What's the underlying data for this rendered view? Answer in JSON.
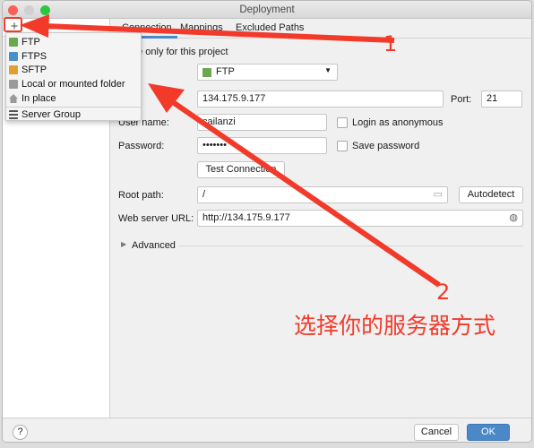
{
  "window": {
    "title": "Deployment"
  },
  "sidebar": {
    "add_button": "+"
  },
  "add_menu": {
    "items": [
      {
        "label": "FTP",
        "icon": "ftp-icon",
        "color": "#6aa84f"
      },
      {
        "label": "FTPS",
        "icon": "ftps-icon",
        "color": "#4a90c8"
      },
      {
        "label": "SFTP",
        "icon": "sftp-icon",
        "color": "#e0a030"
      },
      {
        "label": "Local or mounted folder",
        "icon": "folder-icon",
        "color": "#9a9a9a"
      },
      {
        "label": "In place",
        "icon": "home-icon",
        "color": "#9a9a9a"
      },
      {
        "label": "Server Group",
        "icon": "list-icon",
        "color": "#555555"
      }
    ]
  },
  "tabs": [
    {
      "label": "Connection",
      "active": true
    },
    {
      "label": "Mappings"
    },
    {
      "label": "Excluded Paths"
    }
  ],
  "form": {
    "visible_only": "Visible only for this project",
    "type_value": "FTP",
    "host_value": "134.175.9.177",
    "port_label": "Port:",
    "port_value": "21",
    "username_label": "User name:",
    "username_value": "cailanzi",
    "login_anonymous": "Login as anonymous",
    "password_label": "Password:",
    "password_value": "•••••••",
    "save_password": "Save password",
    "test_connection": "Test Connection",
    "root_path_label": "Root path:",
    "root_path_value": "/",
    "autodetect": "Autodetect",
    "web_url_label": "Web server URL:",
    "web_url_value": "http://134.175.9.177",
    "advanced": "Advanced"
  },
  "footer": {
    "help": "?",
    "cancel": "Cancel",
    "ok": "OK"
  },
  "annotations": {
    "n1": "1",
    "n2": "2",
    "caption": "选择你的服务器方式",
    "color": "#f23a2a"
  }
}
